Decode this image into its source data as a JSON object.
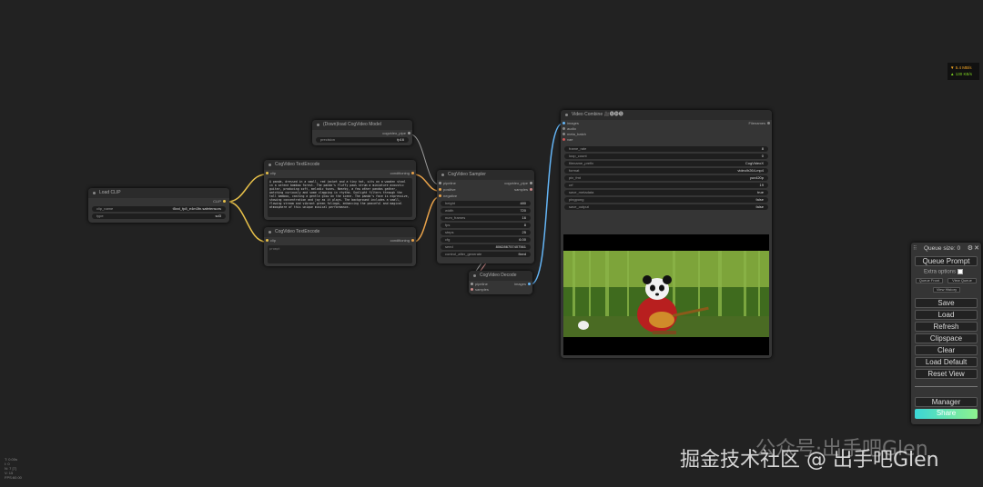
{
  "stats": {
    "line1": "▼ 5.4 MB/s",
    "line2": "▲ 130 KB/s",
    "color1": "#f5a623",
    "color2": "#7ed321"
  },
  "fps": {
    "text": "T: 0.00s\nI: 0\nN: 7 [7]\nV: 15\nFPS:60.00"
  },
  "nodes": {
    "load_clip": {
      "title": "Load CLIP",
      "output": "CLIP",
      "clip_name_label": "clip_name",
      "clip_name_value": "t5xxl_fp8_e4m3fn.safetensors",
      "type_label": "type",
      "type_value": "sd3"
    },
    "download_model": {
      "title": "(Down)load CogVideo Model",
      "output": "cogvideo_pipe",
      "precision_label": "precision",
      "precision_value": "fp16"
    },
    "text_encode_pos": {
      "title": "CogVideo TextEncode",
      "input": "clip",
      "output": "conditioning",
      "prompt": "A panda, dressed in a small, red jacket and a tiny hat, sits on a wooden stool in a serene bamboo forest. The panda's fluffy paws strum a miniature acoustic guitar, producing soft, melodic tunes. Nearby, a few other pandas gather, watching curiously and some clapping in rhythm. Sunlight filters through the tall bamboo, casting a gentle glow on the scene. The panda's face is expressive, showing concentration and joy as it plays. The background includes a small, flowing stream and vibrant green foliage, enhancing the peaceful and magical atmosphere of this unique musical performance."
    },
    "text_encode_neg": {
      "title": "CogVideo TextEncode",
      "input": "clip",
      "output": "conditioning",
      "prompt": "prompt"
    },
    "sampler": {
      "title": "CogVideo Sampler",
      "inputs": [
        "pipeline",
        "positive",
        "negative"
      ],
      "outputs": [
        "cogvideo_pipe",
        "samples"
      ],
      "widgets": [
        {
          "label": "height",
          "value": "480"
        },
        {
          "label": "width",
          "value": "720"
        },
        {
          "label": "num_frames",
          "value": "16"
        },
        {
          "label": "fps",
          "value": "8"
        },
        {
          "label": "steps",
          "value": "25"
        },
        {
          "label": "cfg",
          "value": "6.00"
        },
        {
          "label": "seed",
          "value": "806286757407561"
        },
        {
          "label": "control_after_generate",
          "value": "fixed"
        }
      ]
    },
    "decode": {
      "title": "CogVideo Decode",
      "inputs": [
        "pipeline",
        "samples"
      ],
      "output": "images"
    },
    "video_combine": {
      "title": "Video Combine 🎥🅥🅗🅢",
      "inputs": [
        "images",
        "audio",
        "meta_batch",
        "vae"
      ],
      "output": "Filenames",
      "widgets": [
        {
          "label": "frame_rate",
          "value": "8"
        },
        {
          "label": "loop_count",
          "value": "0"
        },
        {
          "label": "filename_prefix",
          "value": "CogVideoX"
        },
        {
          "label": "format",
          "value": "video/h264-mp4"
        },
        {
          "label": "pix_fmt",
          "value": "yuv420p"
        },
        {
          "label": "crf",
          "value": "19"
        },
        {
          "label": "save_metadata",
          "value": "true"
        },
        {
          "label": "pingpong",
          "value": "false"
        },
        {
          "label": "save_output",
          "value": "false"
        }
      ]
    }
  },
  "queue_panel": {
    "queue_size": "Queue size: 0",
    "queue_prompt": "Queue Prompt",
    "extra_options": "Extra options",
    "queue_front": "Queue Front",
    "view_queue": "View Queue",
    "view_history": "View History",
    "buttons": [
      "Save",
      "Load",
      "Refresh",
      "Clipspace",
      "Clear",
      "Load Default",
      "Reset View"
    ],
    "manager": "Manager",
    "share": "Share"
  },
  "watermark": {
    "text": "掘金技术社区 @ 出手吧Glen",
    "logo": "公众号·出手吧Glen"
  }
}
